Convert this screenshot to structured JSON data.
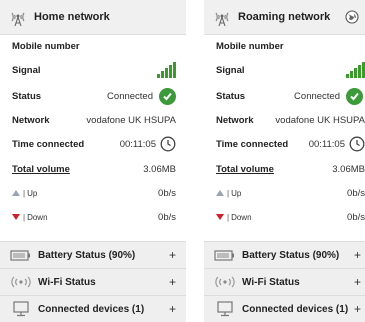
{
  "home": {
    "title": "Home network",
    "mobile_number_label": "Mobile number",
    "signal_label": "Signal",
    "status_label": "Status",
    "status_value": "Connected",
    "network_label": "Network",
    "network_value": "vodafone UK HSUPA",
    "time_label": "Time connected",
    "time_value": "00:11:05",
    "total_label": "Total volume",
    "total_value": "3.06MB",
    "up_label": "Up",
    "up_value": "0b/s",
    "down_label": "Down",
    "down_value": "0b/s",
    "sections": {
      "battery": "Battery Status (90%)",
      "wifi": "Wi-Fi Status",
      "devices": "Connected devices (1)",
      "plus": "+"
    }
  },
  "roaming": {
    "title": "Roaming network",
    "mobile_number_label": "Mobile number",
    "signal_label": "Signal",
    "status_label": "Status",
    "status_value": "Connected",
    "network_label": "Network",
    "network_value": "vodafone UK HSUPA",
    "time_label": "Time connected",
    "time_value": "00:11:05",
    "total_label": "Total volume",
    "total_value": "3.06MB",
    "up_label": "Up",
    "up_value": "0b/s",
    "down_label": "Down",
    "down_value": "0b/s",
    "sections": {
      "battery": "Battery Status (90%)",
      "wifi": "Wi-Fi Status",
      "devices": "Connected devices (1)",
      "plus": "+"
    }
  },
  "icons": [
    "antenna-icon",
    "globe-icon",
    "signal-bars-icon",
    "check-icon",
    "clock-icon",
    "up-arrow-icon",
    "down-arrow-icon",
    "battery-icon",
    "wifi-icon",
    "monitor-icon"
  ],
  "colors": {
    "signal": "#3a9a2a",
    "check": "#3c9a3a",
    "up_arrow": "#9aa4b4",
    "down_arrow": "#d0202a",
    "section_bg": "#efefef"
  }
}
